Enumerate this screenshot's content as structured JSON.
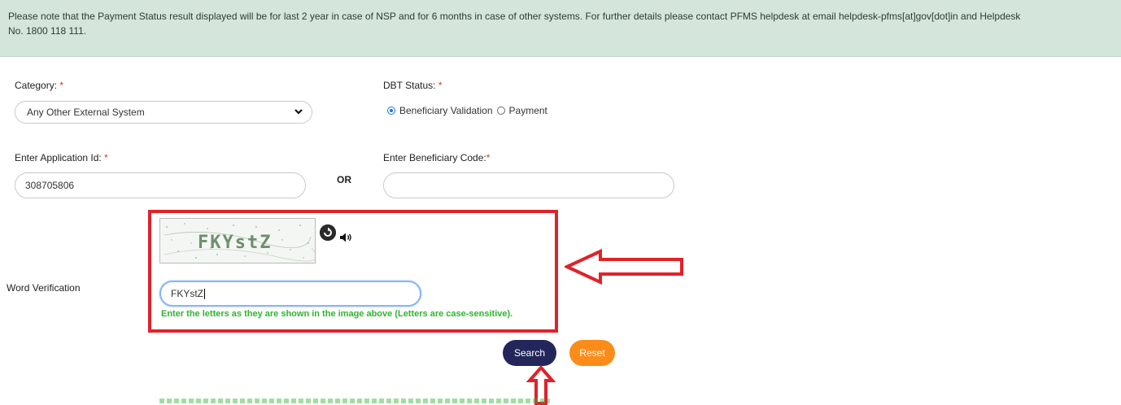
{
  "notice": {
    "line1": "Please note that the Payment Status result displayed will be for last 2 year in case of NSP and for 6 months in case of other systems. For further details please contact PFMS helpdesk at email helpdesk-pfms[at]gov[dot]in and Helpdesk",
    "line2": "No. 1800 118 111."
  },
  "category": {
    "label": "Category:",
    "required_mark": "*",
    "selected": "Any Other External System"
  },
  "dbt_status": {
    "label": "DBT Status:",
    "required_mark": "*",
    "options": [
      {
        "label": "Beneficiary Validation",
        "checked": true
      },
      {
        "label": "Payment",
        "checked": false
      }
    ]
  },
  "application_id": {
    "label": "Enter Application Id:",
    "required_mark": "*",
    "value": "308705806"
  },
  "or_text": "OR",
  "beneficiary_code": {
    "label": "Enter Beneficiary Code:",
    "required_mark": "*",
    "value": ""
  },
  "word_verification": {
    "label": "Word Verification",
    "captcha_text": "FKYstZ",
    "input_value": "FKYstZ",
    "hint": "Enter the letters as they are shown in the image above (Letters are case-sensitive)."
  },
  "buttons": {
    "search": "Search",
    "reset": "Reset"
  },
  "colors": {
    "notice_bg": "#d4e6dc",
    "highlight": "#e0222b",
    "search_btn": "#23265a",
    "reset_btn": "#fb8c1a",
    "hint": "#2fb52f"
  },
  "icons": [
    "chevron-down-icon",
    "refresh-icon",
    "audio-icon",
    "arrow-left-icon",
    "arrow-up-icon"
  ]
}
